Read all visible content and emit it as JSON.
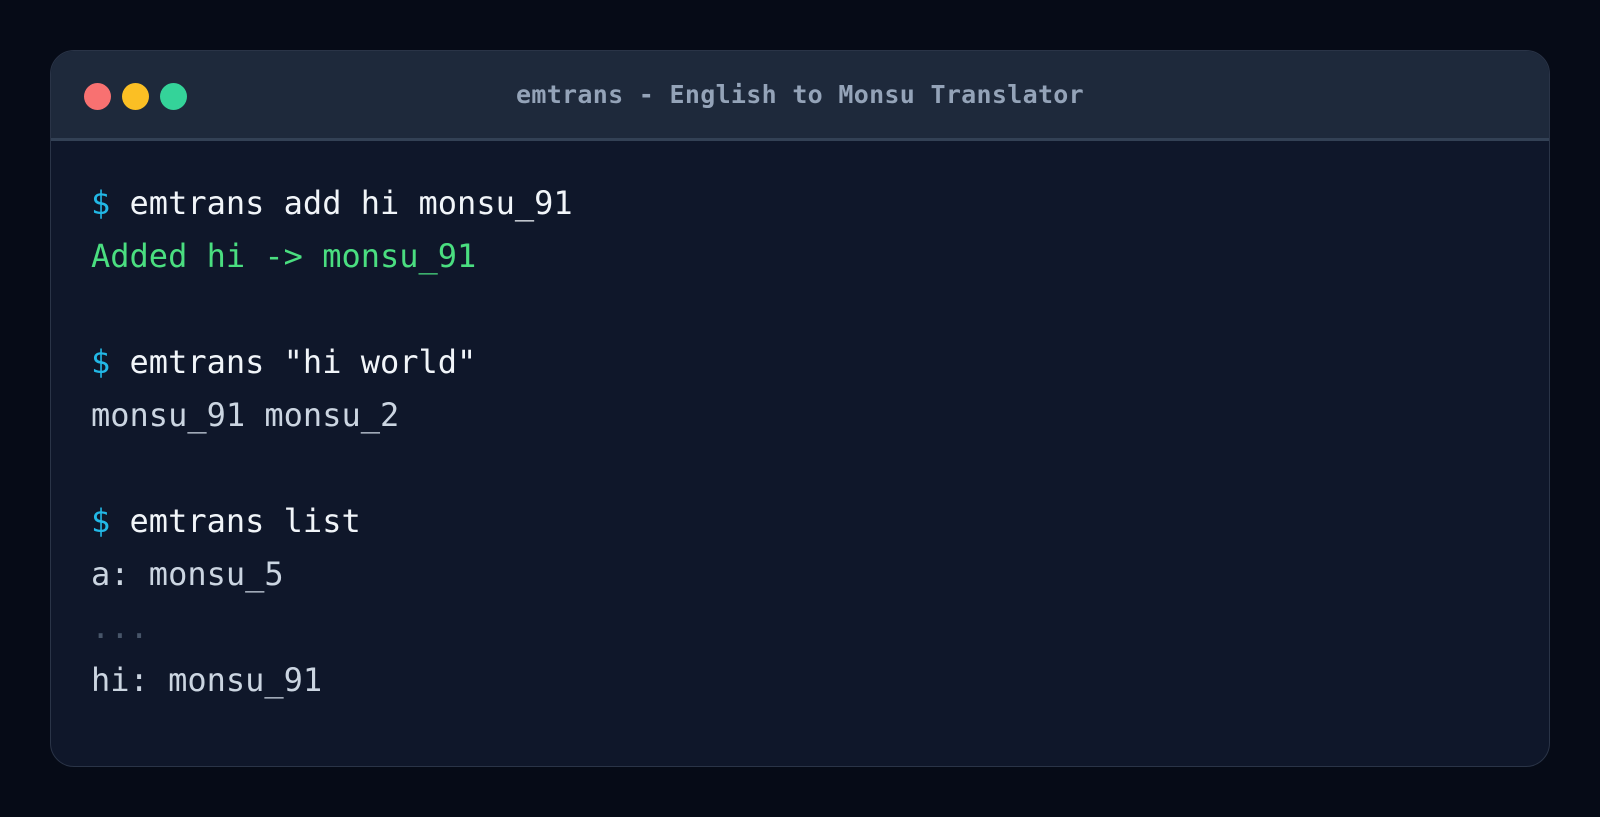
{
  "window": {
    "title": "emtrans - English to Monsu Translator",
    "controls": [
      "close",
      "minimize",
      "maximize"
    ]
  },
  "colors": {
    "background": "#060b17",
    "terminal": "#0f172a",
    "titlebar": "#1e293b",
    "prompt": "#22b8e6",
    "success": "#4ade80",
    "output": "#cbd5e1",
    "close": "#f87171",
    "minimize": "#fbbf24",
    "maximize": "#34d399"
  },
  "terminal": {
    "prompt_symbol": "$",
    "session": [
      {
        "command": "emtrans add hi monsu_91",
        "output": "Added hi -> monsu_91"
      },
      {
        "command": "emtrans \"hi world\"",
        "output": "monsu_91 monsu_2"
      },
      {
        "command": "emtrans list",
        "output_lines": [
          "a: monsu_5",
          "...",
          "hi: monsu_91"
        ]
      }
    ]
  }
}
